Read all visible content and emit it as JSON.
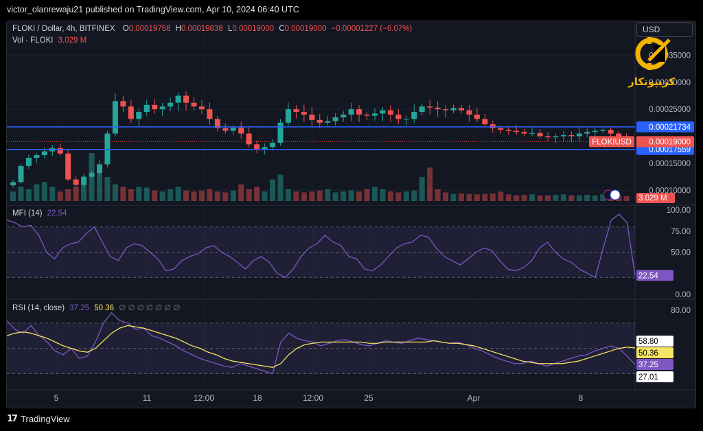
{
  "header": {
    "published_by": "victor_olanrewaju21 published on TradingView.com, Apr 10, 2024 06:40 UTC"
  },
  "price_legend": {
    "symbol": "FLOKI / Dollar, 4h, BITFINEX",
    "o_label": "O",
    "o_value": "0.00019758",
    "h_label": "H",
    "h_value": "0.00019838",
    "l_label": "L",
    "l_value": "0.00019000",
    "c_label": "C",
    "c_value": "0.00019000",
    "change": "−0.00001227 (−6.07%)"
  },
  "volume_legend": {
    "label": "Vol · FLOKI",
    "value": "3.029 M"
  },
  "currency_button": "USD",
  "watermark_text": "کریپوتکار",
  "mfi_legend": {
    "label": "MFI (14)",
    "value": "22.54"
  },
  "rsi_legend": {
    "label": "RSI (14, close)",
    "rsi_value": "37.25",
    "ma_value": "50.36",
    "extra": "∅ ∅ ∅ ∅ ∅ ∅ ∅"
  },
  "footer": {
    "brand": "TradingView",
    "glyph": "17"
  },
  "colors": {
    "up": "#26a69a",
    "down": "#ef5350",
    "line": "#2962ff",
    "mfi": "#7e57c2",
    "rsi_ma": "#f7e463",
    "bg": "#131722"
  },
  "chart_data": [
    {
      "type": "candlestick",
      "title": "FLOKI / Dollar, 4h, BITFINEX",
      "ylim": [
        8e-05,
        0.0004
      ],
      "y_ticks": [
        "0.00035000",
        "0.00030000",
        "0.00025000",
        "0.00015000",
        "0.00010000"
      ],
      "horizontal_levels": [
        {
          "value": 0.00021734,
          "label": "0.00021734"
        },
        {
          "value": 0.00017559,
          "label": "0.00017559"
        }
      ],
      "last_price": {
        "symbol": "FLOKIUSD",
        "value": "0.00019000"
      },
      "volume_label": "3.029 M",
      "x_ticks": [
        "5",
        "11",
        "12:00",
        "18",
        "12:00",
        "25",
        "Apr",
        "8"
      ],
      "price_path": [
        0.000115,
        0.000145,
        0.00016,
        0.000165,
        0.000172,
        0.000178,
        0.000168,
        0.00012,
        0.00011,
        0.000125,
        0.000132,
        0.000148,
        0.000205,
        0.000265,
        0.000255,
        0.000232,
        0.000245,
        0.000258,
        0.00025,
        0.000255,
        0.000262,
        0.000275,
        0.000262,
        0.000255,
        0.00025,
        0.000232,
        0.000215,
        0.00021,
        0.000216,
        0.000205,
        0.000185,
        0.000176,
        0.00018,
        0.000188,
        0.000225,
        0.00025,
        0.000245,
        0.00024,
        0.00023,
        0.000225,
        0.000228,
        0.000235,
        0.00024,
        0.00025,
        0.00024,
        0.000238,
        0.000242,
        0.000248,
        0.00024,
        0.000232,
        0.000232,
        0.000245,
        0.000255,
        0.000253,
        0.00025,
        0.000248,
        0.000252,
        0.000248,
        0.00024,
        0.000232,
        0.000222,
        0.000215,
        0.000212,
        0.00021,
        0.000208,
        0.000205,
        0.000206,
        0.0002,
        0.000198,
        0.0002,
        0.000202,
        0.0002,
        0.000205,
        0.000208,
        0.00021,
        0.000212,
        0.000205,
        0.000198,
        0.00019
      ],
      "volume_path": [
        0.2,
        0.3,
        0.25,
        0.35,
        0.4,
        0.3,
        0.2,
        0.25,
        0.3,
        0.4,
        1.0,
        0.6,
        0.5,
        0.35,
        0.3,
        0.25,
        0.3,
        0.28,
        0.22,
        0.2,
        0.25,
        0.3,
        0.22,
        0.2,
        0.22,
        0.25,
        0.2,
        0.18,
        0.22,
        0.35,
        0.25,
        0.3,
        0.2,
        0.45,
        0.55,
        0.25,
        0.2,
        0.18,
        0.2,
        0.22,
        0.25,
        0.18,
        0.2,
        0.22,
        0.2,
        0.25,
        0.3,
        0.25,
        0.2,
        0.18,
        0.2,
        0.22,
        0.5,
        0.7,
        0.25,
        0.18,
        0.15,
        0.16,
        0.15,
        0.14,
        0.15,
        0.16,
        0.2,
        0.14,
        0.12,
        0.13,
        0.14,
        0.12,
        0.12,
        0.13,
        0.14,
        0.12,
        0.12,
        0.13,
        0.12,
        0.14,
        0.13,
        0.12,
        0.1
      ]
    },
    {
      "type": "line",
      "title": "MFI (14)",
      "ylim": [
        0,
        100
      ],
      "y_ticks": [
        "100.00",
        "75.00",
        "50.00",
        "0.00"
      ],
      "bands": [
        80,
        50,
        20
      ],
      "last_value": "22.54",
      "series": [
        {
          "name": "MFI",
          "values": [
            88,
            85,
            80,
            82,
            70,
            50,
            42,
            55,
            60,
            62,
            72,
            80,
            62,
            45,
            40,
            55,
            60,
            58,
            50,
            42,
            28,
            30,
            40,
            45,
            48,
            55,
            58,
            50,
            45,
            38,
            30,
            40,
            45,
            38,
            25,
            20,
            30,
            45,
            55,
            60,
            70,
            62,
            58,
            45,
            42,
            30,
            28,
            35,
            45,
            55,
            60,
            62,
            70,
            68,
            55,
            45,
            40,
            35,
            42,
            50,
            55,
            52,
            40,
            30,
            28,
            32,
            40,
            55,
            62,
            50,
            42,
            38,
            30,
            25,
            20,
            55,
            88,
            95,
            85,
            22.54
          ]
        }
      ]
    },
    {
      "type": "line",
      "title": "RSI (14, close)",
      "ylim": [
        20,
        85
      ],
      "y_ticks": [
        "80.00"
      ],
      "bands": [
        70,
        50,
        30
      ],
      "last_values": {
        "rsi": "37.25",
        "ma": "50.36",
        "upper": "58.80",
        "lower": "27.01"
      },
      "series": [
        {
          "name": "RSI",
          "values": [
            72,
            65,
            62,
            68,
            60,
            55,
            48,
            45,
            50,
            42,
            44,
            55,
            70,
            78,
            72,
            70,
            65,
            66,
            60,
            58,
            55,
            52,
            48,
            45,
            42,
            40,
            38,
            36,
            35,
            38,
            36,
            34,
            32,
            30,
            55,
            62,
            58,
            56,
            55,
            52,
            54,
            56,
            57,
            55,
            53,
            52,
            54,
            56,
            55,
            54,
            56,
            58,
            57,
            56,
            55,
            54,
            55,
            53,
            50,
            48,
            45,
            42,
            40,
            38,
            38,
            40,
            38,
            36,
            38,
            40,
            42,
            44,
            45,
            48,
            50,
            52,
            50,
            44,
            37.25
          ]
        },
        {
          "name": "RSI-based MA",
          "values": [
            60,
            62,
            63,
            62,
            60,
            58,
            55,
            52,
            50,
            48,
            47,
            50,
            56,
            62,
            66,
            68,
            67,
            66,
            64,
            62,
            60,
            58,
            55,
            52,
            50,
            47,
            45,
            42,
            40,
            39,
            38,
            37,
            36,
            35,
            38,
            45,
            50,
            53,
            54,
            55,
            55,
            55,
            55,
            55,
            55,
            54,
            54,
            55,
            55,
            55,
            55,
            55,
            55,
            56,
            55,
            54,
            54,
            53,
            52,
            50,
            48,
            46,
            44,
            42,
            40,
            39,
            38,
            38,
            38,
            38,
            39,
            40,
            42,
            44,
            46,
            48,
            50,
            51,
            50.36
          ]
        }
      ]
    }
  ]
}
